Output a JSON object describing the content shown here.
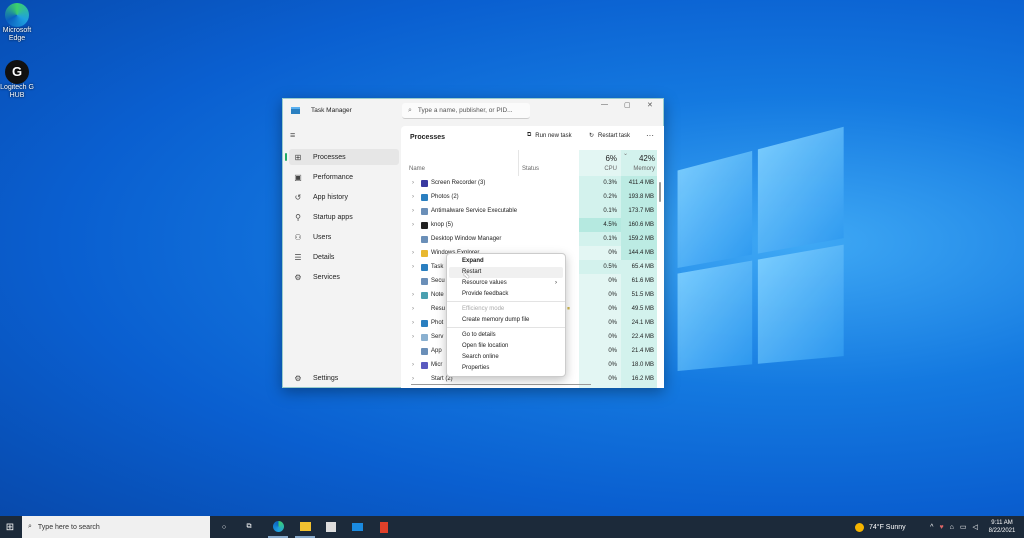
{
  "desktop": {
    "icons": [
      {
        "label": "Microsoft Edge"
      },
      {
        "label": "Logitech G HUB"
      }
    ]
  },
  "window": {
    "title": "Task Manager",
    "search_placeholder": "Type a name, publisher, or PID...",
    "controls": {
      "minimize": "—",
      "maximize": "▢",
      "close": "✕"
    }
  },
  "sidebar": {
    "menu_icon": "≡",
    "items": [
      {
        "label": "Processes",
        "icon": "processes-icon",
        "glyph": "⊞"
      },
      {
        "label": "Performance",
        "icon": "performance-icon",
        "glyph": "▣"
      },
      {
        "label": "App history",
        "icon": "app-history-icon",
        "glyph": "↺"
      },
      {
        "label": "Startup apps",
        "icon": "startup-icon",
        "glyph": "⚲"
      },
      {
        "label": "Users",
        "icon": "users-icon",
        "glyph": "⚇"
      },
      {
        "label": "Details",
        "icon": "details-icon",
        "glyph": "☰"
      },
      {
        "label": "Services",
        "icon": "services-icon",
        "glyph": "⚙"
      }
    ],
    "settings": "Settings"
  },
  "toolbar": {
    "title": "Processes",
    "run_new_task": "Run new task",
    "restart_task": "Restart task",
    "more": "···"
  },
  "columns": {
    "name": "Name",
    "status": "Status",
    "cpu_total": "6%",
    "cpu": "CPU",
    "mem_total": "42%",
    "memory": "Memory"
  },
  "processes": [
    {
      "name": "Screen Recorder (3)",
      "expand": true,
      "color": "#3a3aa0",
      "cpu": "0.3%",
      "mem": "411.4 MB"
    },
    {
      "name": "Photos (2)",
      "expand": true,
      "color": "#2a7fc0",
      "cpu": "0.2%",
      "mem": "193.8 MB"
    },
    {
      "name": "Antimalware Service Executable",
      "expand": true,
      "color": "#6a8fb8",
      "cpu": "0.1%",
      "mem": "173.7 MB"
    },
    {
      "name": "knop (5)",
      "expand": true,
      "color": "#222222",
      "cpu": "4.5%",
      "mem": "160.6 MB"
    },
    {
      "name": "Desktop Window Manager",
      "expand": false,
      "color": "#6a8fb8",
      "cpu": "0.1%",
      "mem": "159.2 MB"
    },
    {
      "name": "Windows Explorer",
      "expand": true,
      "color": "#e8b830",
      "cpu": "0%",
      "mem": "144.4 MB"
    },
    {
      "name": "Task",
      "expand": true,
      "color": "#2a7fc0",
      "cpu": "0.5%",
      "mem": "65.4 MB"
    },
    {
      "name": "Secu",
      "expand": false,
      "color": "#6a8fb8",
      "cpu": "0%",
      "mem": "61.6 MB"
    },
    {
      "name": "Note",
      "expand": true,
      "color": "#4aa0b0",
      "cpu": "0%",
      "mem": "51.5 MB"
    },
    {
      "name": "Resu",
      "expand": true,
      "color": "transparent",
      "cpu": "0%",
      "mem": "49.5 MB",
      "status_icon": "⏸"
    },
    {
      "name": "Phot",
      "expand": true,
      "color": "#2a7fc0",
      "cpu": "0%",
      "mem": "24.1 MB"
    },
    {
      "name": "Serv",
      "expand": true,
      "color": "#8ab0d0",
      "cpu": "0%",
      "mem": "22.4 MB"
    },
    {
      "name": "App",
      "expand": false,
      "color": "#6a8fb8",
      "cpu": "0%",
      "mem": "21.4 MB"
    },
    {
      "name": "Micr",
      "expand": true,
      "color": "#5a5ac0",
      "cpu": "0%",
      "mem": "18.0 MB"
    },
    {
      "name": "Start (2)",
      "expand": true,
      "color": "transparent",
      "cpu": "0%",
      "mem": "16.2 MB"
    }
  ],
  "context_menu": {
    "items": [
      {
        "label": "Expand",
        "bold": true
      },
      {
        "label": "Restart",
        "hover": true
      },
      {
        "label": "Resource values",
        "submenu": true
      },
      {
        "label": "Provide feedback"
      },
      {
        "label": "Efficiency mode",
        "disabled": true
      },
      {
        "label": "Create memory dump file"
      },
      {
        "label": "Go to details"
      },
      {
        "label": "Open file location"
      },
      {
        "label": "Search online"
      },
      {
        "label": "Properties"
      }
    ]
  },
  "taskbar": {
    "search_placeholder": "Type here to search",
    "weather": "74°F  Sunny",
    "time": "9:11 AM",
    "date": "8/22/2021"
  }
}
